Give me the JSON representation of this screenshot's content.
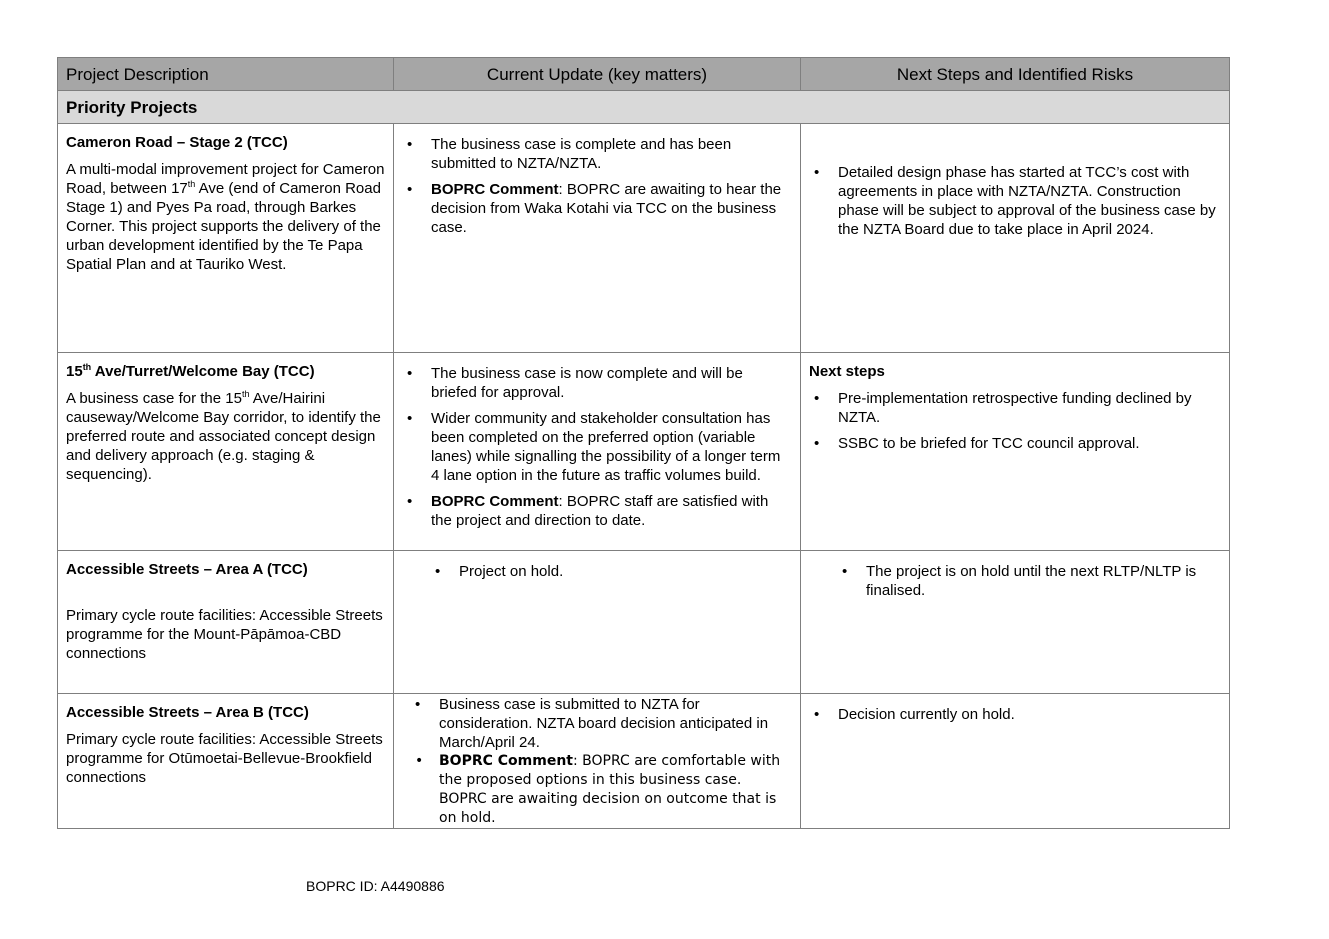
{
  "headers": [
    "Project Description",
    "Current Update (key matters)",
    "Next Steps and Identified Risks"
  ],
  "section_title": "Priority Projects",
  "rows": [
    {
      "title": "Cameron Road – Stage 2 (TCC)",
      "description_pre": "A multi-modal improvement project for Cameron Road, between 17",
      "description_sup": "th",
      "description_post": " Ave (end of Cameron Road Stage 1) and Pyes Pa road, through Barkes Corner. This project supports the delivery of the urban development identified by the Te Papa Spatial Plan and at Tauriko West.",
      "update_1": "The business case is complete and has been submitted to NZTA/NZTA.",
      "update_2_label": "BOPRC Comment",
      "update_2_text": ": BOPRC are awaiting to hear the decision from Waka Kotahi via TCC on the business case.",
      "next_1": "Detailed design phase has started at TCC’s cost with agreements in place with NZTA/NZTA. Construction phase will be subject to approval of the business case by the NZTA Board due to take place in April 2024."
    },
    {
      "title_pre": "15",
      "title_sup": "th",
      "title_post": " Ave/Turret/Welcome Bay (TCC)",
      "description_pre": "A business case for the 15",
      "description_sup": "th",
      "description_post": " Ave/Hairini causeway/Welcome Bay corridor, to identify the preferred route and associated concept design and delivery approach (e.g. staging & sequencing).",
      "update_1": "The business case is now complete and will be briefed for approval.",
      "update_2": "Wider community and stakeholder consultation has been completed on the preferred option (variable lanes) while signalling the possibility of a longer term 4 lane option in the future as traffic volumes build.",
      "update_3_label": "BOPRC Comment",
      "update_3_text": ": BOPRC staff are satisfied with the project and direction to date.",
      "next_heading": "Next steps",
      "next_1": "Pre-implementation retrospective funding declined by NZTA.",
      "next_2": "SSBC to be briefed for TCC council approval."
    },
    {
      "title": "Accessible Streets – Area A (TCC)",
      "description": "Primary cycle route facilities: Accessible Streets programme for the Mount-Pāpāmoa-CBD connections",
      "update_1": "Project on hold.",
      "next_1": "The project is on hold until the next RLTP/NLTP is finalised."
    },
    {
      "title": "Accessible Streets – Area B (TCC)",
      "description": "Primary cycle route facilities: Accessible Streets programme for Otūmoetai-Bellevue-Brookfield connections",
      "update_1": "Business case is submitted to NZTA for consideration. NZTA board decision anticipated in March/April 24.",
      "update_2_label": "BOPRC Comment",
      "update_2_text": ": BOPRC are comfortable with the proposed options in this business case. BOPRC are awaiting decision on outcome that is on hold.",
      "next_1": "Decision currently on hold."
    }
  ],
  "footer": "BOPRC ID: A4490886"
}
